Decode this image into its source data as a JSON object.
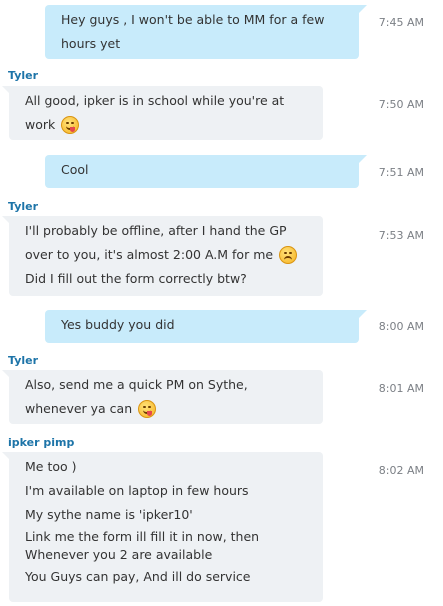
{
  "messages": [
    {
      "lines": [
        "Hey guys , I won't be able to MM for a few",
        "hours yet"
      ],
      "time": "7:45 AM"
    },
    {
      "sender": "Tyler",
      "lines": [
        "All good, ipker is in school while you're at",
        "work"
      ],
      "time": "7:50 AM",
      "emoji": "tongue-out-icon"
    },
    {
      "lines": [
        "Cool"
      ],
      "time": "7:51 AM"
    },
    {
      "sender": "Tyler",
      "lines": [
        "I'll probably be offline, after I hand the GP",
        "over to you, it's almost 2:00 A.M for me",
        "Did I fill out the form correctly btw?"
      ],
      "time": "7:53 AM",
      "emoji": "worried-face-icon"
    },
    {
      "lines": [
        "Yes buddy you did"
      ],
      "time": "8:00 AM"
    },
    {
      "sender": "Tyler",
      "lines": [
        "Also, send me a quick PM on Sythe,",
        "whenever ya can"
      ],
      "time": "8:01 AM",
      "emoji": "tongue-out-icon"
    },
    {
      "sender": "ipker pimp",
      "lines": [
        "Me too )",
        "I'm available on laptop in few hours",
        "My sythe name is 'ipker10'",
        "Link me the form ill fill it in now, then",
        "Whenever you 2 are available",
        "You Guys can pay, And ill do service"
      ],
      "time": "8:02 AM"
    }
  ]
}
